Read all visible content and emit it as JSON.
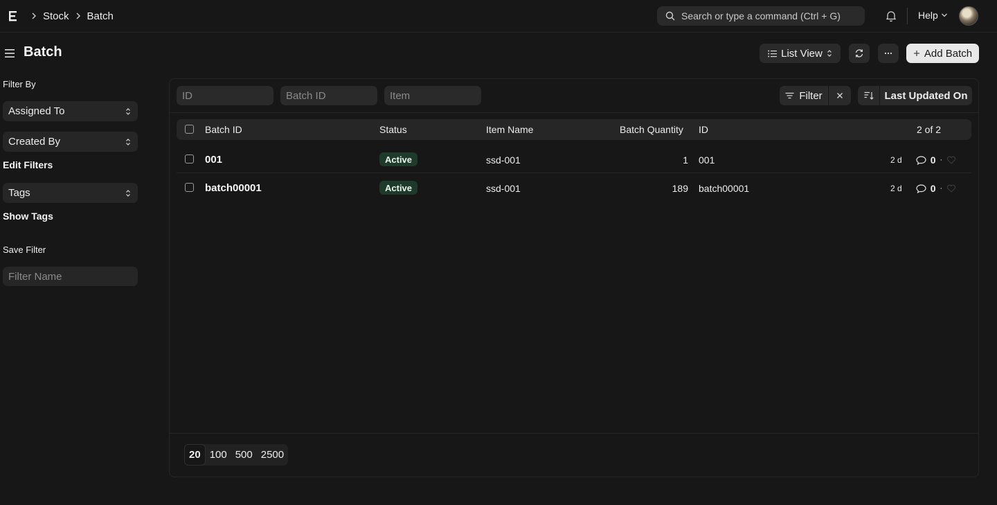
{
  "breadcrumbs": [
    "Stock",
    "Batch"
  ],
  "search": {
    "placeholder": "Search or type a command (Ctrl + G)"
  },
  "help_label": "Help",
  "page": {
    "title": "Batch",
    "view_label": "List View",
    "add_label": "Add Batch"
  },
  "sidebar": {
    "filter_by": "Filter By",
    "assigned_to": "Assigned To",
    "created_by": "Created By",
    "edit_filters": "Edit Filters",
    "tags": "Tags",
    "show_tags": "Show Tags",
    "save_filter": "Save Filter",
    "filter_name_placeholder": "Filter Name"
  },
  "filters": {
    "id_placeholder": "ID",
    "batch_id_placeholder": "Batch ID",
    "item_placeholder": "Item",
    "filter_label": "Filter",
    "sort_label": "Last Updated On"
  },
  "table": {
    "columns": [
      "Batch ID",
      "Status",
      "Item Name",
      "Batch Quantity",
      "ID"
    ],
    "count": "2 of 2",
    "rows": [
      {
        "batch_id": "001",
        "status": "Active",
        "item_name": "ssd-001",
        "quantity": "1",
        "id": "001",
        "modified": "2 d",
        "comments": "0"
      },
      {
        "batch_id": "batch00001",
        "status": "Active",
        "item_name": "ssd-001",
        "quantity": "189",
        "id": "batch00001",
        "modified": "2 d",
        "comments": "0"
      }
    ]
  },
  "paging": [
    "20",
    "100",
    "500",
    "2500"
  ],
  "colors": {
    "background": "#171717",
    "surface": "#2a2a2a",
    "badge_green": "#1d3a2a",
    "primary_button": "#e8e8e8"
  }
}
